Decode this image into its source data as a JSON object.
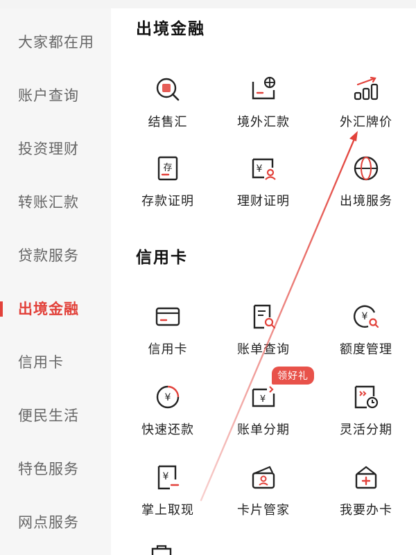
{
  "sidebar": {
    "items": [
      {
        "label": "大家都在用"
      },
      {
        "label": "账户查询"
      },
      {
        "label": "投资理财"
      },
      {
        "label": "转账汇款"
      },
      {
        "label": "贷款服务"
      },
      {
        "label": "出境金融",
        "active": true
      },
      {
        "label": "信用卡"
      },
      {
        "label": "便民生活"
      },
      {
        "label": "特色服务"
      },
      {
        "label": "网点服务"
      }
    ]
  },
  "sections": {
    "outbound": {
      "title": "出境金融",
      "items": [
        {
          "label": "结售汇",
          "icon": "exchange-search-icon"
        },
        {
          "label": "境外汇款",
          "icon": "globe-transfer-icon"
        },
        {
          "label": "外汇牌价",
          "icon": "bar-chart-trend-icon"
        },
        {
          "label": "存款证明",
          "icon": "deposit-certificate-icon"
        },
        {
          "label": "理财证明",
          "icon": "wealth-certificate-icon"
        },
        {
          "label": "出境服务",
          "icon": "globe-icon"
        }
      ]
    },
    "credit": {
      "title": "信用卡",
      "items": [
        {
          "label": "信用卡",
          "icon": "credit-card-icon"
        },
        {
          "label": "账单查询",
          "icon": "bill-search-icon"
        },
        {
          "label": "额度管理",
          "icon": "limit-search-icon"
        },
        {
          "label": "快速还款",
          "icon": "yuan-circle-icon"
        },
        {
          "label": "账单分期",
          "icon": "bill-installment-icon"
        },
        {
          "label": "灵活分期",
          "icon": "flexible-installment-icon"
        },
        {
          "label": "掌上取现",
          "icon": "cash-withdraw-icon"
        },
        {
          "label": "卡片管家",
          "icon": "card-wallet-icon"
        },
        {
          "label": "我要办卡",
          "icon": "apply-card-icon"
        }
      ],
      "badge": "领好礼"
    }
  },
  "colors": {
    "accent": "#e2413a",
    "sidebar_bg": "#f6f6f6"
  }
}
